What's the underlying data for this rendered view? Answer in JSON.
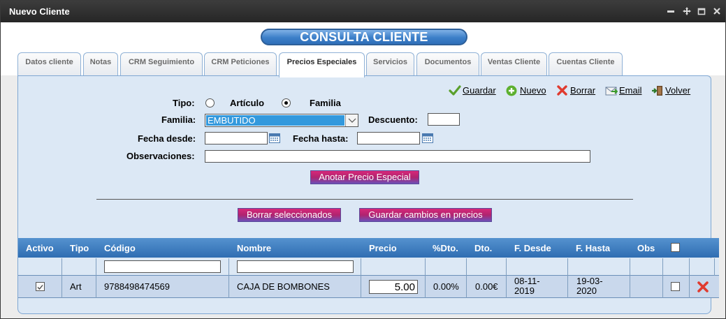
{
  "window": {
    "title": "Nuevo Cliente"
  },
  "header": {
    "banner": "CONSULTA CLIENTE"
  },
  "tabs": [
    {
      "label": "Datos cliente"
    },
    {
      "label": "Notas"
    },
    {
      "label": "CRM Seguimiento"
    },
    {
      "label": "CRM Peticiones"
    },
    {
      "label": "Precios Especiales",
      "active": true
    },
    {
      "label": "Servicios"
    },
    {
      "label": "Documentos"
    },
    {
      "label": "Ventas Cliente"
    },
    {
      "label": "Cuentas Cliente"
    }
  ],
  "toolbar": {
    "guardar": "Guardar",
    "nuevo": "Nuevo",
    "borrar": "Borrar",
    "email": "Email",
    "volver": "Volver"
  },
  "form": {
    "tipo_label": "Tipo:",
    "tipo_options": [
      "Artículo",
      "Familia"
    ],
    "tipo_selected": "Familia",
    "familia_label": "Familia:",
    "familia_value": "EMBUTIDO",
    "descuento_label": "Descuento:",
    "descuento_value": "",
    "fecha_desde_label": "Fecha desde:",
    "fecha_desde_value": "",
    "fecha_hasta_label": "Fecha hasta:",
    "fecha_hasta_value": "",
    "observaciones_label": "Observaciones:",
    "observaciones_value": "",
    "anotar_button": "Anotar Precio Especial",
    "borrar_sel_button": "Borrar seleccionados",
    "guardar_cambios_button": "Guardar cambios en precios"
  },
  "grid": {
    "columns": [
      "Activo",
      "Tipo",
      "Código",
      "Nombre",
      "Precio",
      "%Dto.",
      "Dto.",
      "F. Desde",
      "F. Hasta",
      "Obs"
    ],
    "filter": {
      "codigo": "",
      "nombre": ""
    },
    "rows": [
      {
        "activo": true,
        "tipo": "Art",
        "codigo": "9788498474569",
        "nombre": "CAJA DE BOMBONES",
        "precio": "5.00",
        "pct_dto": "0.00%",
        "dto": "0.00€",
        "f_desde_1": "08-11-",
        "f_desde_2": "2019",
        "f_hasta_1": "19-03-",
        "f_hasta_2": "2020",
        "selected": false
      }
    ]
  },
  "colors": {
    "accent_blue": "#2f6db2",
    "button_magenta": "#b0246f",
    "panel_bg": "#dce8f5"
  }
}
